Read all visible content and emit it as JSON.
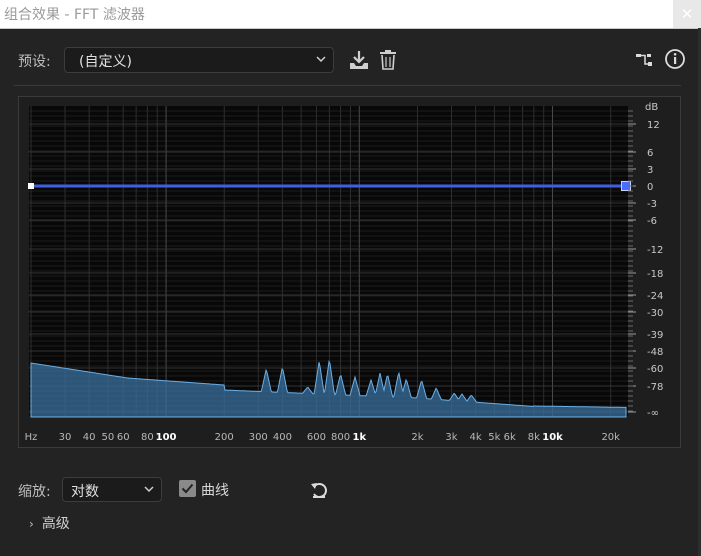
{
  "window": {
    "title": "组合效果 - FFT 滤波器",
    "close_glyph": "✕"
  },
  "preset": {
    "label": "预设:",
    "value": "(自定义)"
  },
  "toolbar": {
    "save_icon": "download-preset-icon",
    "delete_icon": "trash-icon",
    "routing_icon": "routing-icon",
    "info_icon": "info-icon"
  },
  "graph": {
    "db_unit": "dB",
    "db_ticks": [
      "12",
      "6",
      "3",
      "0",
      "-3",
      "-6",
      "-12",
      "-18",
      "-24",
      "-30",
      "-39",
      "-48",
      "-60",
      "-78",
      "-∞"
    ],
    "freq_ticks": [
      "Hz",
      "30",
      "40",
      "50",
      "60",
      "80",
      "100",
      "200",
      "300",
      "400",
      "600",
      "800",
      "1k",
      "2k",
      "3k",
      "4k",
      "5k",
      "6k",
      "8k",
      "10k",
      "20k"
    ],
    "filter_curve_gain_db": 0,
    "curve_color": "#3f5fe0",
    "spectrum_color": "#5fa0d8",
    "points": [
      {
        "name": "point-left",
        "freq_hz": 20,
        "gain_db": 0
      },
      {
        "name": "point-right",
        "freq_hz": 24000,
        "gain_db": 0
      }
    ]
  },
  "controls": {
    "scale_label": "缩放:",
    "scale_value": "对数",
    "curve_checked": true,
    "curve_label": "曲线",
    "reset_icon": "reset-icon",
    "advanced_label": "高级",
    "advanced_arrow": "›"
  }
}
